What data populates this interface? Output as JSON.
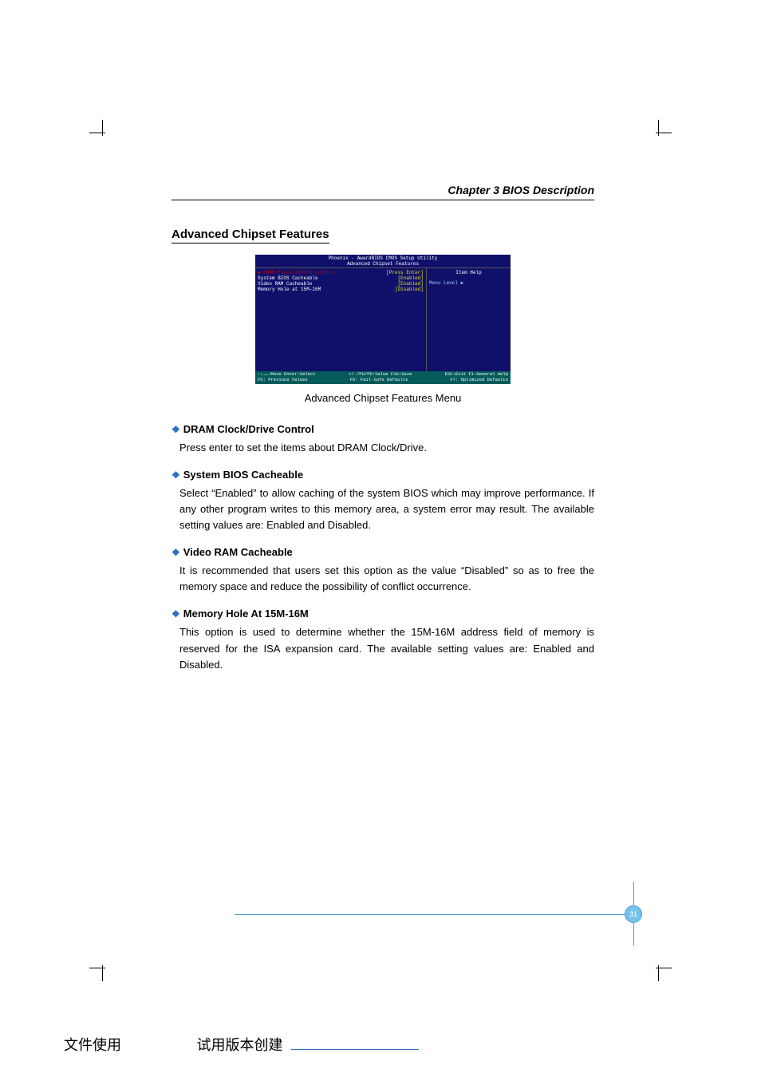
{
  "header": {
    "chapter": "Chapter 3   BIOS Description"
  },
  "section": {
    "title": "Advanced Chipset Features"
  },
  "bios": {
    "title1": "Phoenix - AwardBIOS CMOS Setup Utility",
    "title2": "Advanced Chipset Features",
    "rows": [
      {
        "label": "▶ DRAM Clock/Timing Control",
        "value": "[Press Enter]",
        "selected": true
      },
      {
        "label": "  System BIOS Cacheable",
        "value": "[Enabled]"
      },
      {
        "label": "  Video  RAM Cacheable",
        "value": "[Enabled]"
      },
      {
        "label": "  Memory Hole at 15M-16M",
        "value": "[Disabled]"
      }
    ],
    "help_title": "Item Help",
    "help_line": "Menu Level   ▶",
    "footer1_left": "↑↓→←:Move  Enter:Select",
    "footer1_mid": "+/-/PU/PD:Value  F10:Save",
    "footer1_right": "ESC:Exit  F1:General Help",
    "footer2_left": "F5: Previous Values",
    "footer2_mid": "F6: Fail-Safe Defaults",
    "footer2_right": "F7: Optimized Defaults"
  },
  "figure_caption": "Advanced Chipset Features Menu",
  "items": [
    {
      "title": "DRAM Clock/Drive Control",
      "body": "Press enter to set the items about DRAM Clock/Drive."
    },
    {
      "title": "System BIOS Cacheable",
      "body": "Select “Enabled” to allow caching of the system BIOS which may improve performance. If any other program writes to this memory area, a system error may result. The available setting values are: Enabled and Disabled."
    },
    {
      "title": "Video RAM Cacheable",
      "body": "It is recommended that users set this option as the value “Disabled” so as to free the memory space and reduce the possibility of conflict occurrence."
    },
    {
      "title": "Memory Hole At 15M-16M",
      "body": "This option is used to determine whether the 15M-16M address field of memory is reserved for the ISA expansion card. The available setting values are: Enabled and Disabled."
    }
  ],
  "page_number": "31",
  "footer_cn": {
    "left": "文件使用",
    "right": "试用版本创建"
  }
}
